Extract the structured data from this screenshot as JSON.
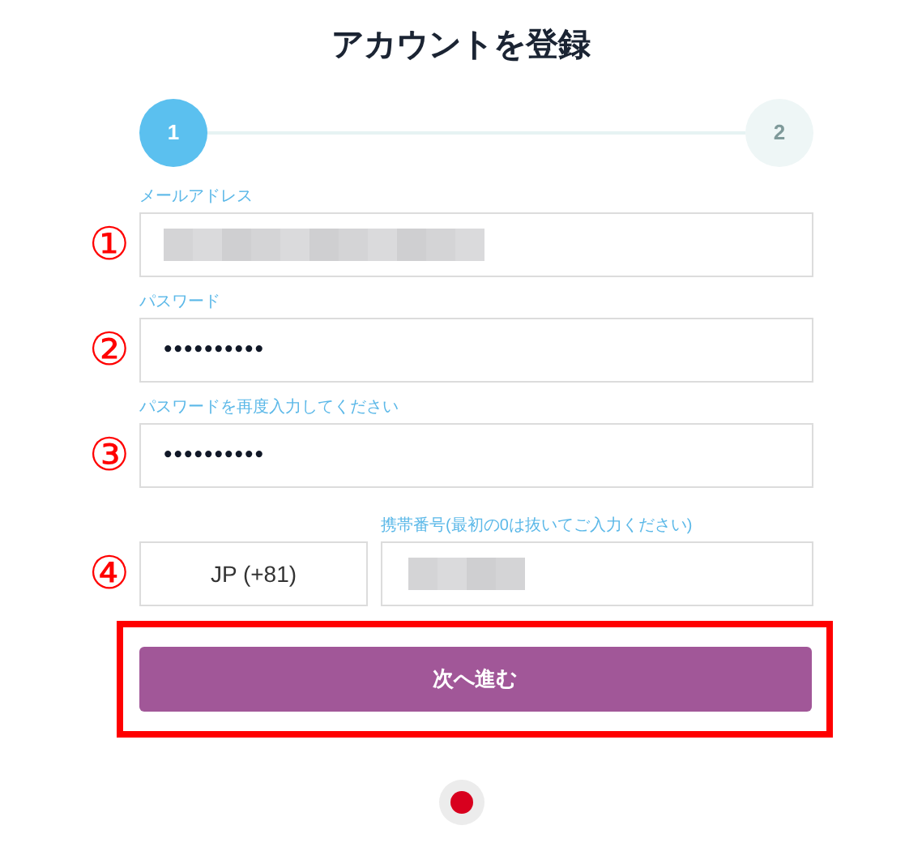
{
  "title": "アカウントを登録",
  "steps": [
    {
      "label": "1",
      "selected": true
    },
    {
      "label": "2",
      "selected": false
    }
  ],
  "fields": [
    {
      "kind": "redacted",
      "label": "メールアドレス",
      "annotation": "①"
    },
    {
      "kind": "password",
      "label": "パスワード",
      "annotation": "②",
      "value": "••••••••••"
    },
    {
      "kind": "password",
      "label": "パスワードを再度入力してください",
      "annotation": "③",
      "value": "••••••••••"
    }
  ],
  "phone": {
    "annotation": "④",
    "country": "JP (+81)",
    "label": "携帯番号(最初の0は抜いてご入力ください)"
  },
  "next_button": {
    "label": "次へ進む",
    "highlighted": true
  }
}
